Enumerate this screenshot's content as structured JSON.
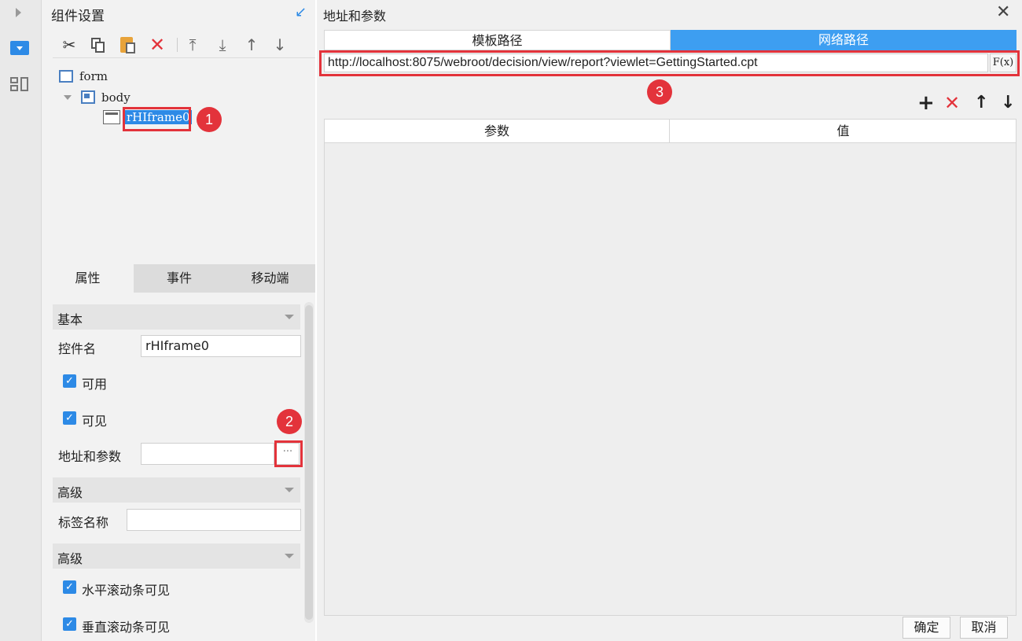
{
  "left_panel": {
    "title": "组件设置",
    "tree": {
      "root": "form",
      "body": "body",
      "widget": "rHIframe0"
    },
    "tabs": [
      "属性",
      "事件",
      "移动端"
    ],
    "sections": {
      "basic": "基本",
      "advanced1": "高级",
      "advanced2": "高级"
    },
    "fields": {
      "widget_name_label": "控件名",
      "widget_name_value": "rHIframe0",
      "enabled_label": "可用",
      "visible_label": "可见",
      "url_params_label": "地址和参数",
      "url_params_value": "",
      "url_params_button": "···",
      "tag_name_label": "标签名称",
      "tag_name_value": "",
      "hscroll_label": "水平滚动条可见",
      "vscroll_label": "垂直滚动条可见"
    }
  },
  "dialog": {
    "title": "地址和参数",
    "tabs": [
      "模板路径",
      "网络路径"
    ],
    "url_value": "http://localhost:8075/webroot/decision/view/report?viewlet=GettingStarted.cpt",
    "formula_button": "F(x)",
    "table_headers": [
      "参数",
      "值"
    ],
    "ok": "确定",
    "cancel": "取消"
  },
  "markers": [
    "1",
    "2",
    "3"
  ],
  "colors": {
    "accent_blue": "#3d9ef1",
    "marker_red": "#e3333b",
    "check_blue": "#2d8ae6"
  }
}
